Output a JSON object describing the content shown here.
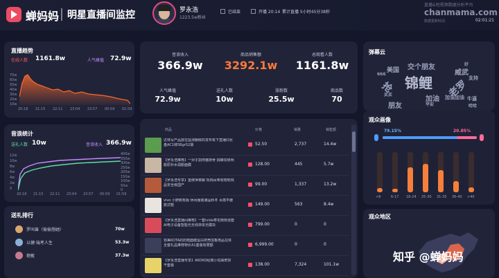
{
  "header": {
    "brand": "蝉妈妈",
    "subtitle": "明星直播间监控",
    "host_name": "罗永浩",
    "host_fans": "1223.5w粉丝",
    "status": "已结束",
    "start_time": "开播 20:14",
    "duration": "累计直播 5小时45分38秒",
    "watermark_line": "直播&短视频数据分析平台",
    "watermark_site": "chanmama.com",
    "elapsed_label": "数据更新时间",
    "elapsed_value": "02:01:21"
  },
  "trend": {
    "title": "直播趋势",
    "online_label": "在线人数",
    "online_value": "1161.8w",
    "popularity_label": "人气峰值",
    "popularity_value": "72.9w",
    "y_ticks": [
      "70w",
      "60w",
      "50w",
      "40w",
      "30w",
      "20w",
      "10w"
    ],
    "x_ticks": [
      "20:18",
      "21:15",
      "22:11",
      "23:04",
      "23:57",
      "00:59",
      "01:59"
    ]
  },
  "sound": {
    "title": "音浪统计",
    "in_label": "送礼人数",
    "in_value": "10w",
    "total_label": "音浪收入",
    "total_value": "366.9w",
    "y_left": [
      "12w",
      "10w",
      "8w",
      "6w",
      "4w",
      "2w",
      "0"
    ],
    "y_right": [
      "400w",
      "350w",
      "300w",
      "250w",
      "200w",
      "150w",
      "100w",
      "50w",
      "0"
    ],
    "x_ticks": [
      "20:18",
      "21:15",
      "22:11",
      "23:04",
      "23:57",
      "00:59",
      "01:59"
    ]
  },
  "gifts": {
    "title": "送礼排行",
    "items": [
      {
        "name": "罗叫兽（偷偷想她）",
        "value": "70w"
      },
      {
        "name": "以健·瑞考人生",
        "value": "53.3w"
      },
      {
        "name": "艳敏",
        "value": "37.3w"
      }
    ]
  },
  "stats": {
    "row1": [
      {
        "label": "音浪收入",
        "value": "366.9w"
      },
      {
        "label": "商品销售额",
        "value": "3292.1w"
      },
      {
        "label": "总观看人数",
        "value": "1161.8w"
      }
    ],
    "row2": [
      {
        "label": "人气峰值",
        "value": "72.9w"
      },
      {
        "label": "送礼人数",
        "value": "10w"
      },
      {
        "label": "涨粉数",
        "value": "25.5w"
      },
      {
        "label": "商品数",
        "value": "70"
      }
    ]
  },
  "table": {
    "headers": [
      "商品",
      "价格",
      "销量",
      "销售额"
    ],
    "rows": [
      {
        "name": "达林写产品放在监测朝鲜的发布有下直播同化盘AC1袜5Bgr52袋",
        "price": "52.50",
        "qty": "2,737",
        "amount": "14.4w",
        "color": "#5b9c4f"
      },
      {
        "name": "【罗永浩推荐】一对子割肉猪排骨 挑螺纹锈明胶原补水润颜面膜",
        "price": "128.00",
        "qty": "445",
        "amount": "5.7w",
        "color": "#c9b7a5"
      },
      {
        "name": "【罗永浩专享】金牌净菜酿 现炖百味有物软炖品安全级国产",
        "price": "99.00",
        "qty": "1,337",
        "amount": "13.2w",
        "color": "#b55b3b"
      },
      {
        "name": "vivo 小野鹅有版 休闲服装潮品秋冬 百搭平腰款式鞋",
        "price": "149.00",
        "qty": "563",
        "amount": "8.4w",
        "color": "#e9e4e0"
      },
      {
        "name": "【罗永浩直播间推荐】一套ivida枣花雨有便套AI电子设备智能光无线单体光模块",
        "price": "799.00",
        "qty": "0",
        "amount": "0",
        "color": "#d84b5a"
      },
      {
        "name": "双美KOTA的防晒面膜蛋白挤壳加香用品在体全套礼品推荐特价A1套装有限额",
        "price": "6,999.00",
        "qty": "0",
        "amount": "0",
        "color": "#3b3f5a"
      },
      {
        "name": "【罗永浩直播专享】AKOKO经典小花曲奇饼干套装",
        "price": "138.00",
        "qty": "7,324",
        "amount": "101.1w",
        "color": "#e8d36b"
      }
    ]
  },
  "cloud": {
    "title": "弹幕云",
    "words": [
      "交个朋友",
      "美国",
      "锦鲤",
      "威武",
      "抢",
      "老罗",
      "加油",
      "好",
      "朋友",
      "平安",
      "牛逼",
      "哈哈",
      "666",
      "加油加油",
      "买买",
      "支持"
    ]
  },
  "audience": {
    "title": "观众画像",
    "male_pct": "79.15%",
    "female_pct": "20.85%",
    "male_ratio": 0.7915,
    "bars": [
      {
        "label": "<6",
        "value": 0.1
      },
      {
        "label": "6-17",
        "value": 0.08
      },
      {
        "label": "18-24",
        "value": 0.62
      },
      {
        "label": "25-30",
        "value": 0.7
      },
      {
        "label": "31-35",
        "value": 0.55
      },
      {
        "label": "36-40",
        "value": 0.28
      },
      {
        "label": ">40",
        "value": 0.12
      }
    ]
  },
  "region": {
    "title": "观众地区"
  },
  "overlay": {
    "zhihu": "知乎 @蝉妈妈"
  }
}
